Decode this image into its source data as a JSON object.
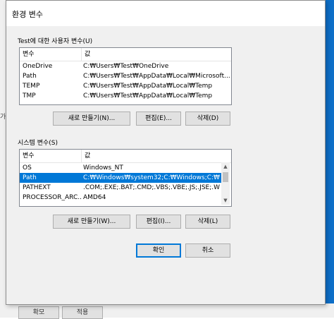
{
  "dialog": {
    "title": "환경 변수"
  },
  "user_vars": {
    "label": "Test에 대한 사용자 변수(U)",
    "columns": [
      "변수",
      "값"
    ],
    "rows": [
      {
        "name": "OneDrive",
        "value": "C:₩Users₩Test₩OneDrive"
      },
      {
        "name": "Path",
        "value": "C:₩Users₩Test₩AppData₩Local₩Microsoft..."
      },
      {
        "name": "TEMP",
        "value": "C:₩Users₩Test₩AppData₩Local₩Temp"
      },
      {
        "name": "TMP",
        "value": "C:₩Users₩Test₩AppData₩Local₩Temp"
      }
    ],
    "new_label": "새로 만들기(N)...",
    "edit_label": "편집(E)...",
    "delete_label": "삭제(D)"
  },
  "system_vars": {
    "label": "시스템 변수(S)",
    "columns": [
      "변수",
      "값"
    ],
    "rows": [
      {
        "name": "OS",
        "value": "Windows_NT"
      },
      {
        "name": "Path",
        "value": "C:₩Windows₩system32;C:₩Windows;C:₩..."
      },
      {
        "name": "PATHEXT",
        "value": ".COM;.EXE;.BAT;.CMD;.VBS;.VBE;.JS;.JSE;.W..."
      },
      {
        "name": "PROCESSOR_ARC...",
        "value": "AMD64"
      }
    ],
    "selected_index": 1,
    "new_label": "새로 만들기(W)...",
    "edit_label": "편집(I)...",
    "delete_label": "삭제(L)"
  },
  "footer": {
    "ok_label": "확인",
    "cancel_label": "취소"
  },
  "background": {
    "left_text": "가",
    "bottom_left_label": "확모",
    "bottom_right_label": "적용"
  },
  "colors": {
    "selection": "#0078d7",
    "accent": "#0078d7"
  }
}
